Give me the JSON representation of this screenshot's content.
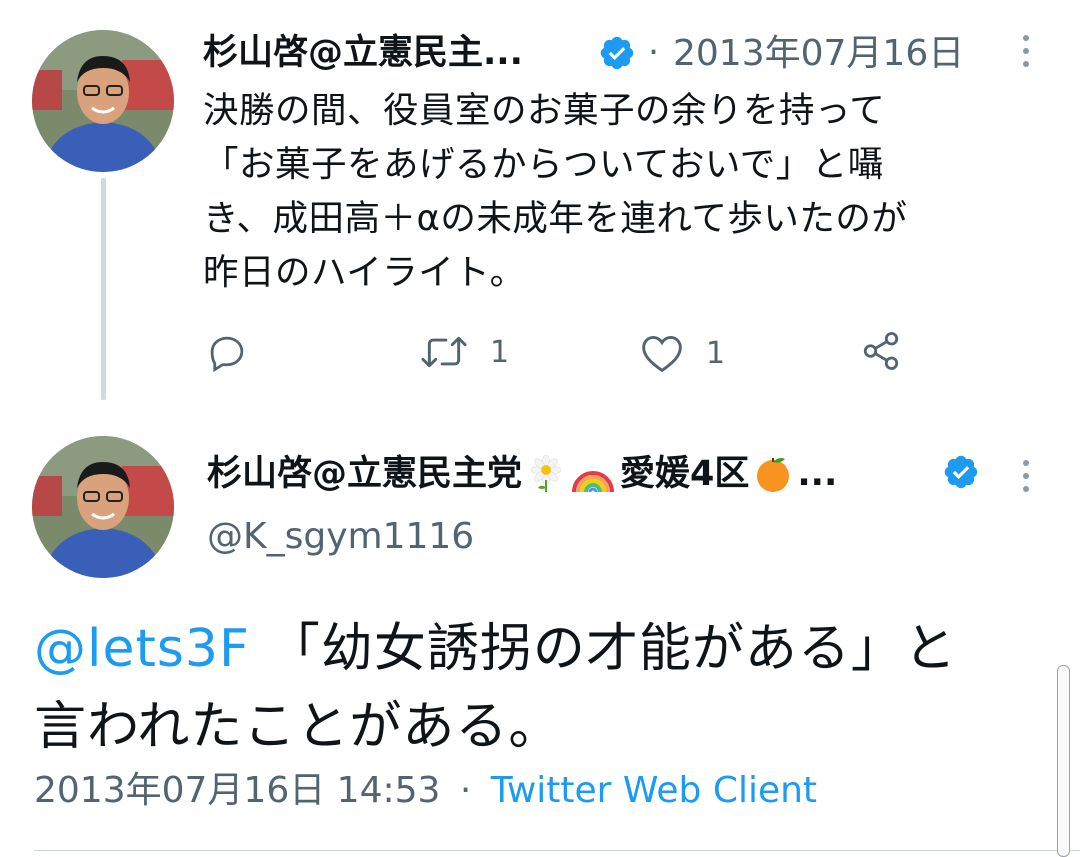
{
  "tweet1": {
    "author_name": "杉山啓@立憲民主...",
    "separator": "·",
    "date": "2013年07月16日",
    "text_lines": [
      "決勝の間、役員室のお菓子の余りを持って",
      "「お菓子をあげるからついておいで」と囁",
      "き、成田高＋αの未成年を連れて歩いたのが",
      "昨日のハイライト。"
    ],
    "actions": {
      "reply_icon": "reply-icon",
      "retweet_icon": "retweet-icon",
      "retweet_count": "1",
      "like_icon": "heart-icon",
      "like_count": "1",
      "share_icon": "share-icon"
    }
  },
  "tweet2": {
    "author_name": "杉山啓@立憲民主党",
    "name_emoji_icons": [
      "daisy-icon",
      "rainbow-icon"
    ],
    "author_name_suffix": "愛媛4区",
    "name_emoji_suffix_icon": "orange-icon",
    "ellipsis": "...",
    "handle": "@K_sgym1116",
    "mention": "@lets3F",
    "text_line1": "「幼女誘拐の才能がある」と",
    "text_line2": "言われたことがある。",
    "timestamp": "2013年07月16日 14:53",
    "separator": "·",
    "source": "Twitter Web Client"
  },
  "colors": {
    "accent": "#1d9bf0",
    "secondary_text": "#536471",
    "primary_text": "#0f1419",
    "verified": "#1d9bf0"
  }
}
